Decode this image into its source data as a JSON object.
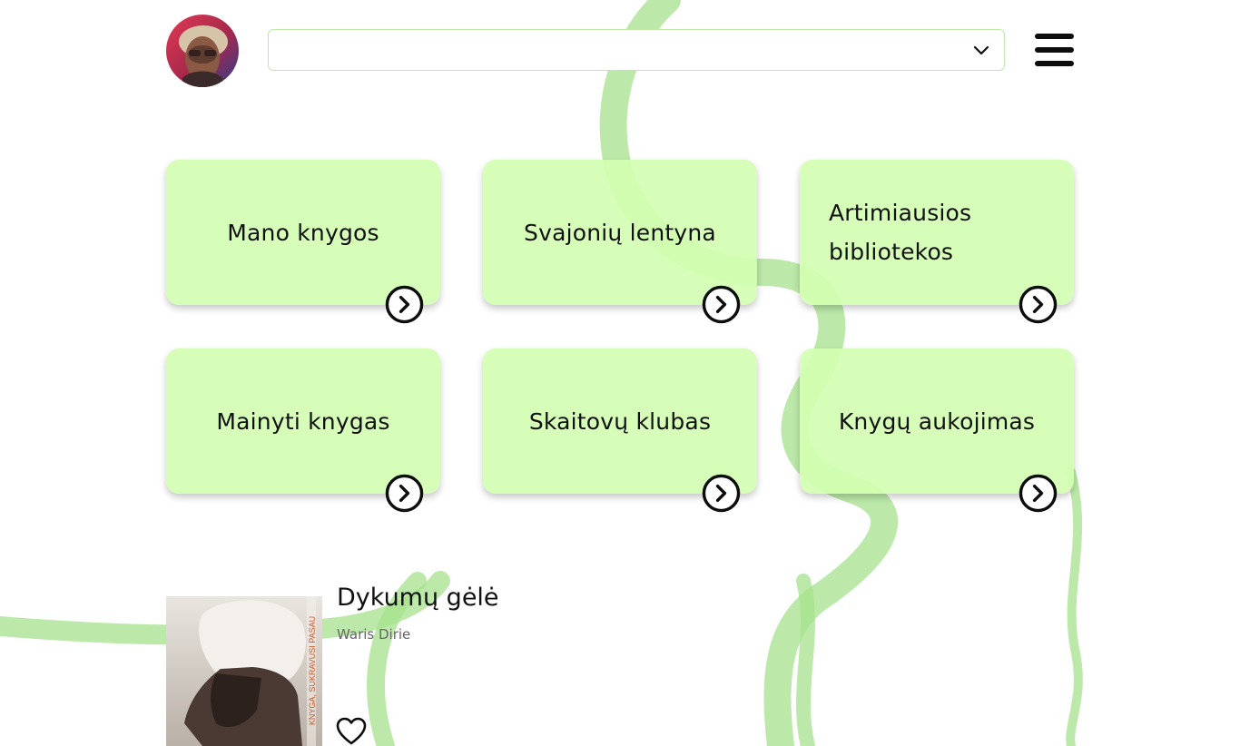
{
  "header": {
    "avatar_icon": "user-avatar",
    "select": {
      "value": "",
      "icon": "chevron-down-icon"
    },
    "menu_icon": "hamburger-menu-icon"
  },
  "cards": [
    {
      "label": "Mano knygos",
      "icon": "arrow-right-circle-icon"
    },
    {
      "label": "Svajonių lentyna",
      "icon": "arrow-right-circle-icon"
    },
    {
      "label": "Artimiausios bibliotekos",
      "icon": "arrow-right-circle-icon"
    },
    {
      "label": "Mainyti knygas",
      "icon": "arrow-right-circle-icon"
    },
    {
      "label": "Skaitovų klubas",
      "icon": "arrow-right-circle-icon"
    },
    {
      "label": "Knygų aukojimas",
      "icon": "arrow-right-circle-icon"
    }
  ],
  "book": {
    "title": "Dykumų gėlė",
    "author": "Waris Dirie",
    "cover_text": "KNYGA, SUKRAVUSI PASAU",
    "favorite_icon": "heart-outline-icon"
  },
  "colors": {
    "card_bg": "#d2feb2",
    "accent_green": "#a8e28a",
    "select_border": "#bfe9a8",
    "text": "#111111"
  }
}
